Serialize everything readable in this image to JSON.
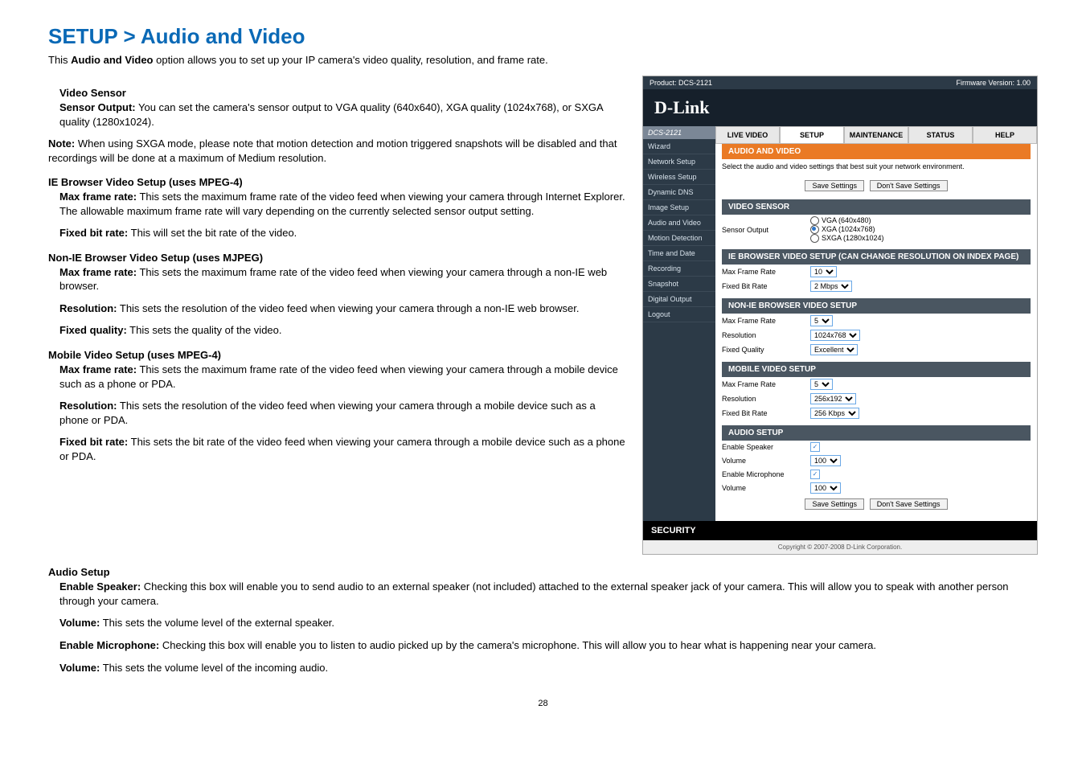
{
  "title": "SETUP > Audio and Video",
  "intro_pre": "This ",
  "intro_bold": "Audio and Video",
  "intro_post": " option allows you to set up your IP camera's video quality, resolution, and frame rate.",
  "sections": {
    "video_sensor": {
      "h": "Video Sensor",
      "sensor_output_l": "Sensor Output:",
      "sensor_output_t": "   You can set the camera's sensor output to VGA quality (640x640), XGA quality (1024x768), or SXGA quality (1280x1024)."
    },
    "note": {
      "l": "Note:",
      "t": "  When using SXGA mode, please note that motion detection and motion triggered snapshots will be disabled and that recordings will be done at a maximum of Medium resolution."
    },
    "ie": {
      "h": "IE Browser Video Setup (uses MPEG-4)",
      "max_l": "Max frame rate:",
      "max_t": "   This sets the maximum frame rate of the video feed when viewing your camera through Internet Explorer. The allowable maximum frame rate will vary depending on the currently selected sensor output setting.",
      "fix_l": "Fixed bit rate:",
      "fix_t": "       This will set the bit rate of the video."
    },
    "nonie": {
      "h": "Non-IE Browser Video Setup (uses MJPEG)",
      "max_l": "Max frame rate:",
      "max_t": "   This sets the maximum frame rate of the video feed when viewing your camera through a non-IE web browser.",
      "res_l": "Resolution:",
      "res_t": "  This sets the resolution of the video feed when viewing your camera through a non-IE web browser.",
      "fix_l": "Fixed quality:",
      "fix_t": "       This sets the quality of the video."
    },
    "mobile": {
      "h": "Mobile Video Setup (uses MPEG-4)",
      "max_l": "Max frame rate:",
      "max_t": "   This sets the maximum frame rate of the video feed when viewing your camera through a mobile device such as a phone or PDA.",
      "res_l": "Resolution:",
      "res_t": "  This sets the resolution of the video feed when viewing your camera through a mobile device such as a phone or PDA.",
      "fix_l": "Fixed bit rate:",
      "fix_t": "       This sets the bit rate of the video feed when viewing your camera through a mobile device such as a phone or PDA."
    },
    "audio": {
      "h": "Audio Setup",
      "spk_l": "Enable Speaker:",
      "spk_t": "   Checking this box will enable you to send audio to an external speaker (not included) attached to the external speaker jack of your camera. This will allow you to speak with another person through your camera.",
      "vol1_l": "Volume:",
      "vol1_t": "  This sets the volume level of the external speaker.",
      "mic_l": "Enable Microphone:",
      "mic_t": "     Checking this box will enable you to listen to audio picked up by the camera's microphone. This will allow you to hear what is happening near your camera.",
      "vol2_l": "Volume:",
      "vol2_t": "  This sets the volume level of the incoming audio."
    }
  },
  "pagenum": "28",
  "ui": {
    "product": "Product: DCS-2121",
    "fw": "Firmware Version: 1.00",
    "logo": "D-Link",
    "model": "DCS-2121",
    "tabs": [
      "LIVE VIDEO",
      "SETUP",
      "MAINTENANCE",
      "STATUS",
      "HELP"
    ],
    "side": [
      "Wizard",
      "Network Setup",
      "Wireless Setup",
      "Dynamic DNS",
      "Image Setup",
      "Audio and Video",
      "Motion Detection",
      "Time and Date",
      "Recording",
      "Snapshot",
      "Digital Output",
      "Logout"
    ],
    "bar_orange": "AUDIO AND VIDEO",
    "desc": "Select the audio and video settings that best suit your network environment.",
    "save": "Save Settings",
    "dont": "Don't Save Settings",
    "bar_vs": "VIDEO SENSOR",
    "vs_label": "Sensor Output",
    "vs_opt1": "VGA (640x480)",
    "vs_opt2": "XGA (1024x768)",
    "vs_opt3": "SXGA (1280x1024)",
    "bar_ie": "IE BROWSER VIDEO SETUP (CAN CHANGE RESOLUTION ON INDEX PAGE)",
    "ie_max_l": "Max Frame Rate",
    "ie_max_v": "10",
    "ie_bit_l": "Fixed Bit Rate",
    "ie_bit_v": "2 Mbps",
    "bar_nonie": "NON-IE BROWSER VIDEO SETUP",
    "ni_max_l": "Max Frame Rate",
    "ni_max_v": "5",
    "ni_res_l": "Resolution",
    "ni_res_v": "1024x768",
    "ni_q_l": "Fixed Quality",
    "ni_q_v": "Excellent",
    "bar_mob": "MOBILE VIDEO SETUP",
    "mb_max_l": "Max Frame Rate",
    "mb_max_v": "5",
    "mb_res_l": "Resolution",
    "mb_res_v": "256x192",
    "mb_bit_l": "Fixed Bit Rate",
    "mb_bit_v": "256 Kbps",
    "bar_audio": "AUDIO SETUP",
    "au_spk_l": "Enable Speaker",
    "au_vol1_l": "Volume",
    "au_vol1_v": "100",
    "au_mic_l": "Enable Microphone",
    "au_vol2_l": "Volume",
    "au_vol2_v": "100",
    "footer": "SECURITY",
    "copy": "Copyright © 2007-2008 D-Link Corporation."
  }
}
